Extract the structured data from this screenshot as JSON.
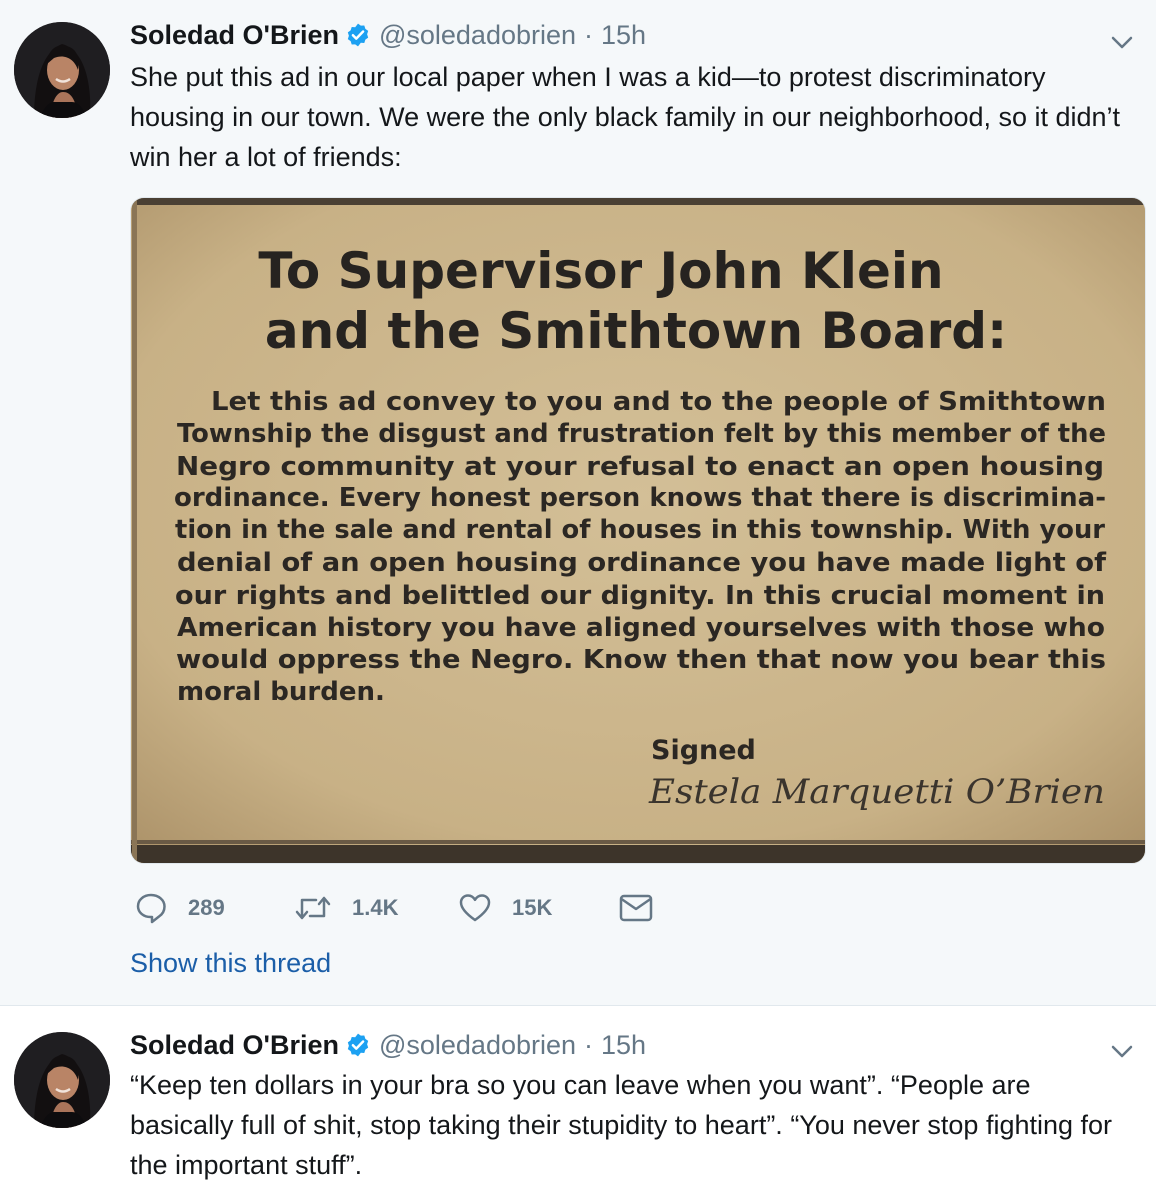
{
  "tweets": [
    {
      "author_name": "Soledad O'Brien",
      "handle": "@soledadobrien",
      "separator": "·",
      "time": "15h",
      "text": "She put this ad in our local paper when I was a kid—to protest discriminatory housing in our town. We were the only black family in our neighborhood, so it didn’t win her a lot of friends:",
      "media": {
        "headline_line1": "To Supervisor John Klein",
        "headline_line2": "and the Smithtown Board:",
        "body_lines": [
          "Let this ad convey to you and to the people of Smithtown",
          "Township the disgust and frustration felt by this member of the",
          "Negro community at your refusal to enact an open housing",
          "ordinance. Every honest person knows that there is discrimina-",
          "tion in the sale and rental of houses in this township. With your",
          "denial of an open housing ordinance you have made light of",
          "our rights and belittled our dignity. In this crucial moment in",
          "American history you have aligned yourselves with those who",
          "would oppress the Negro. Know then that now you bear this",
          "moral burden."
        ],
        "signed_label": "Signed",
        "signature": "Estela Marquetti O’Brien"
      },
      "replies": "289",
      "retweets": "1.4K",
      "likes": "15K",
      "show_thread": "Show this thread"
    },
    {
      "author_name": "Soledad O'Brien",
      "handle": "@soledadobrien",
      "separator": "·",
      "time": "15h",
      "text": "“Keep ten dollars in your bra so you can leave when you want”. “People are basically full of shit, stop taking their stupidity to heart”. “You never stop fighting for the important stuff”."
    }
  ],
  "colors": {
    "verified": "#1da1f2",
    "link": "#1b5ea8",
    "muted": "#657786",
    "newsprint": "#cdb88f"
  },
  "icons": [
    "verified-badge-icon",
    "chevron-down-icon",
    "reply-icon",
    "retweet-icon",
    "like-heart-icon",
    "direct-message-icon"
  ]
}
